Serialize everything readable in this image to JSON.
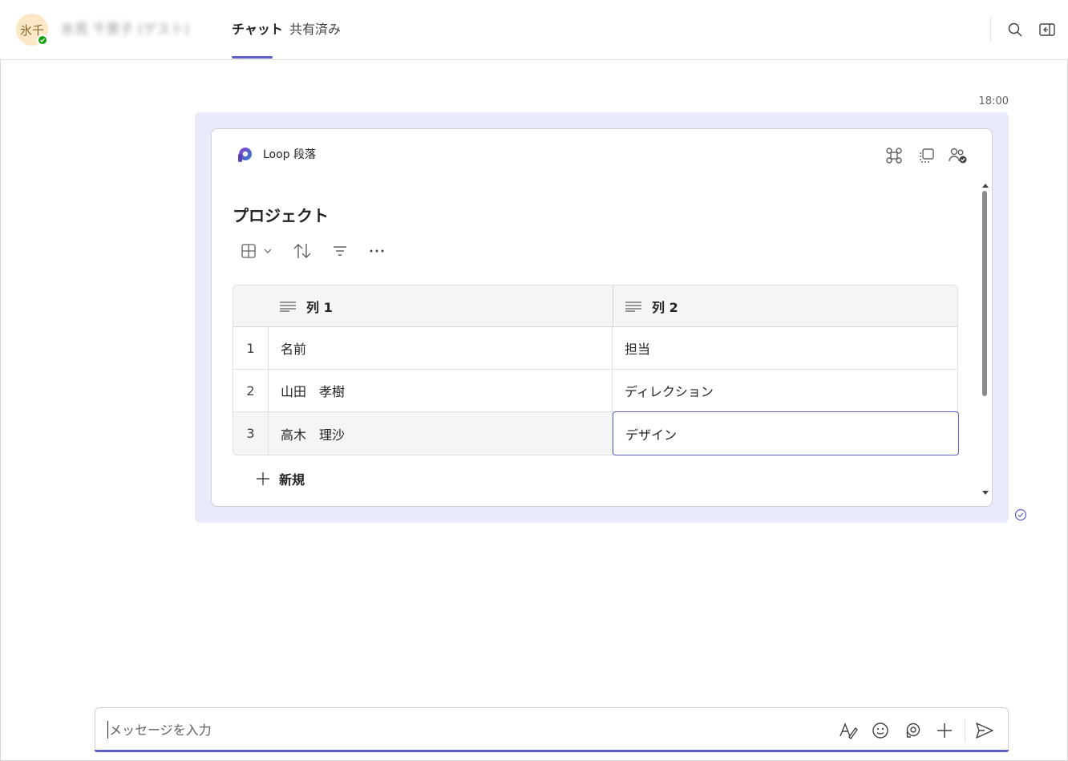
{
  "header": {
    "avatar_initials": "氷千",
    "contact_name": "氷見 千景子 (ゲスト)",
    "tabs": [
      {
        "label": "チャット",
        "active": true
      },
      {
        "label": "共有済み",
        "active": false
      }
    ],
    "icons": [
      "search-icon",
      "open-side-panel-icon"
    ]
  },
  "message": {
    "timestamp": "18:00",
    "loop_card": {
      "label": "Loop 段落",
      "header_icons": [
        "loop-app-icon",
        "copy-component-icon",
        "shared-access-icon"
      ],
      "title": "プロジェクト",
      "toolbar_icons": [
        "table-view-icon",
        "chevron-down-icon",
        "sort-icon",
        "filter-icon",
        "more-icon"
      ],
      "table": {
        "columns": [
          "列 1",
          "列 2"
        ],
        "rows": [
          {
            "num": "1",
            "c1": "名前",
            "c2": "担当"
          },
          {
            "num": "2",
            "c1": "山田　孝樹",
            "c2": "ディレクション"
          },
          {
            "num": "3",
            "c1": "高木　理沙",
            "c2": "デザイン"
          }
        ],
        "new_row_label": "新規"
      }
    }
  },
  "compose": {
    "placeholder": "メッセージを入力",
    "icons": [
      "format-icon",
      "emoji-icon",
      "loop-compose-icon",
      "attach-plus-icon",
      "send-icon"
    ]
  },
  "colors": {
    "accent": "#5b5fc7",
    "bubble": "#e8ebfa",
    "presence": "#13a10e"
  }
}
